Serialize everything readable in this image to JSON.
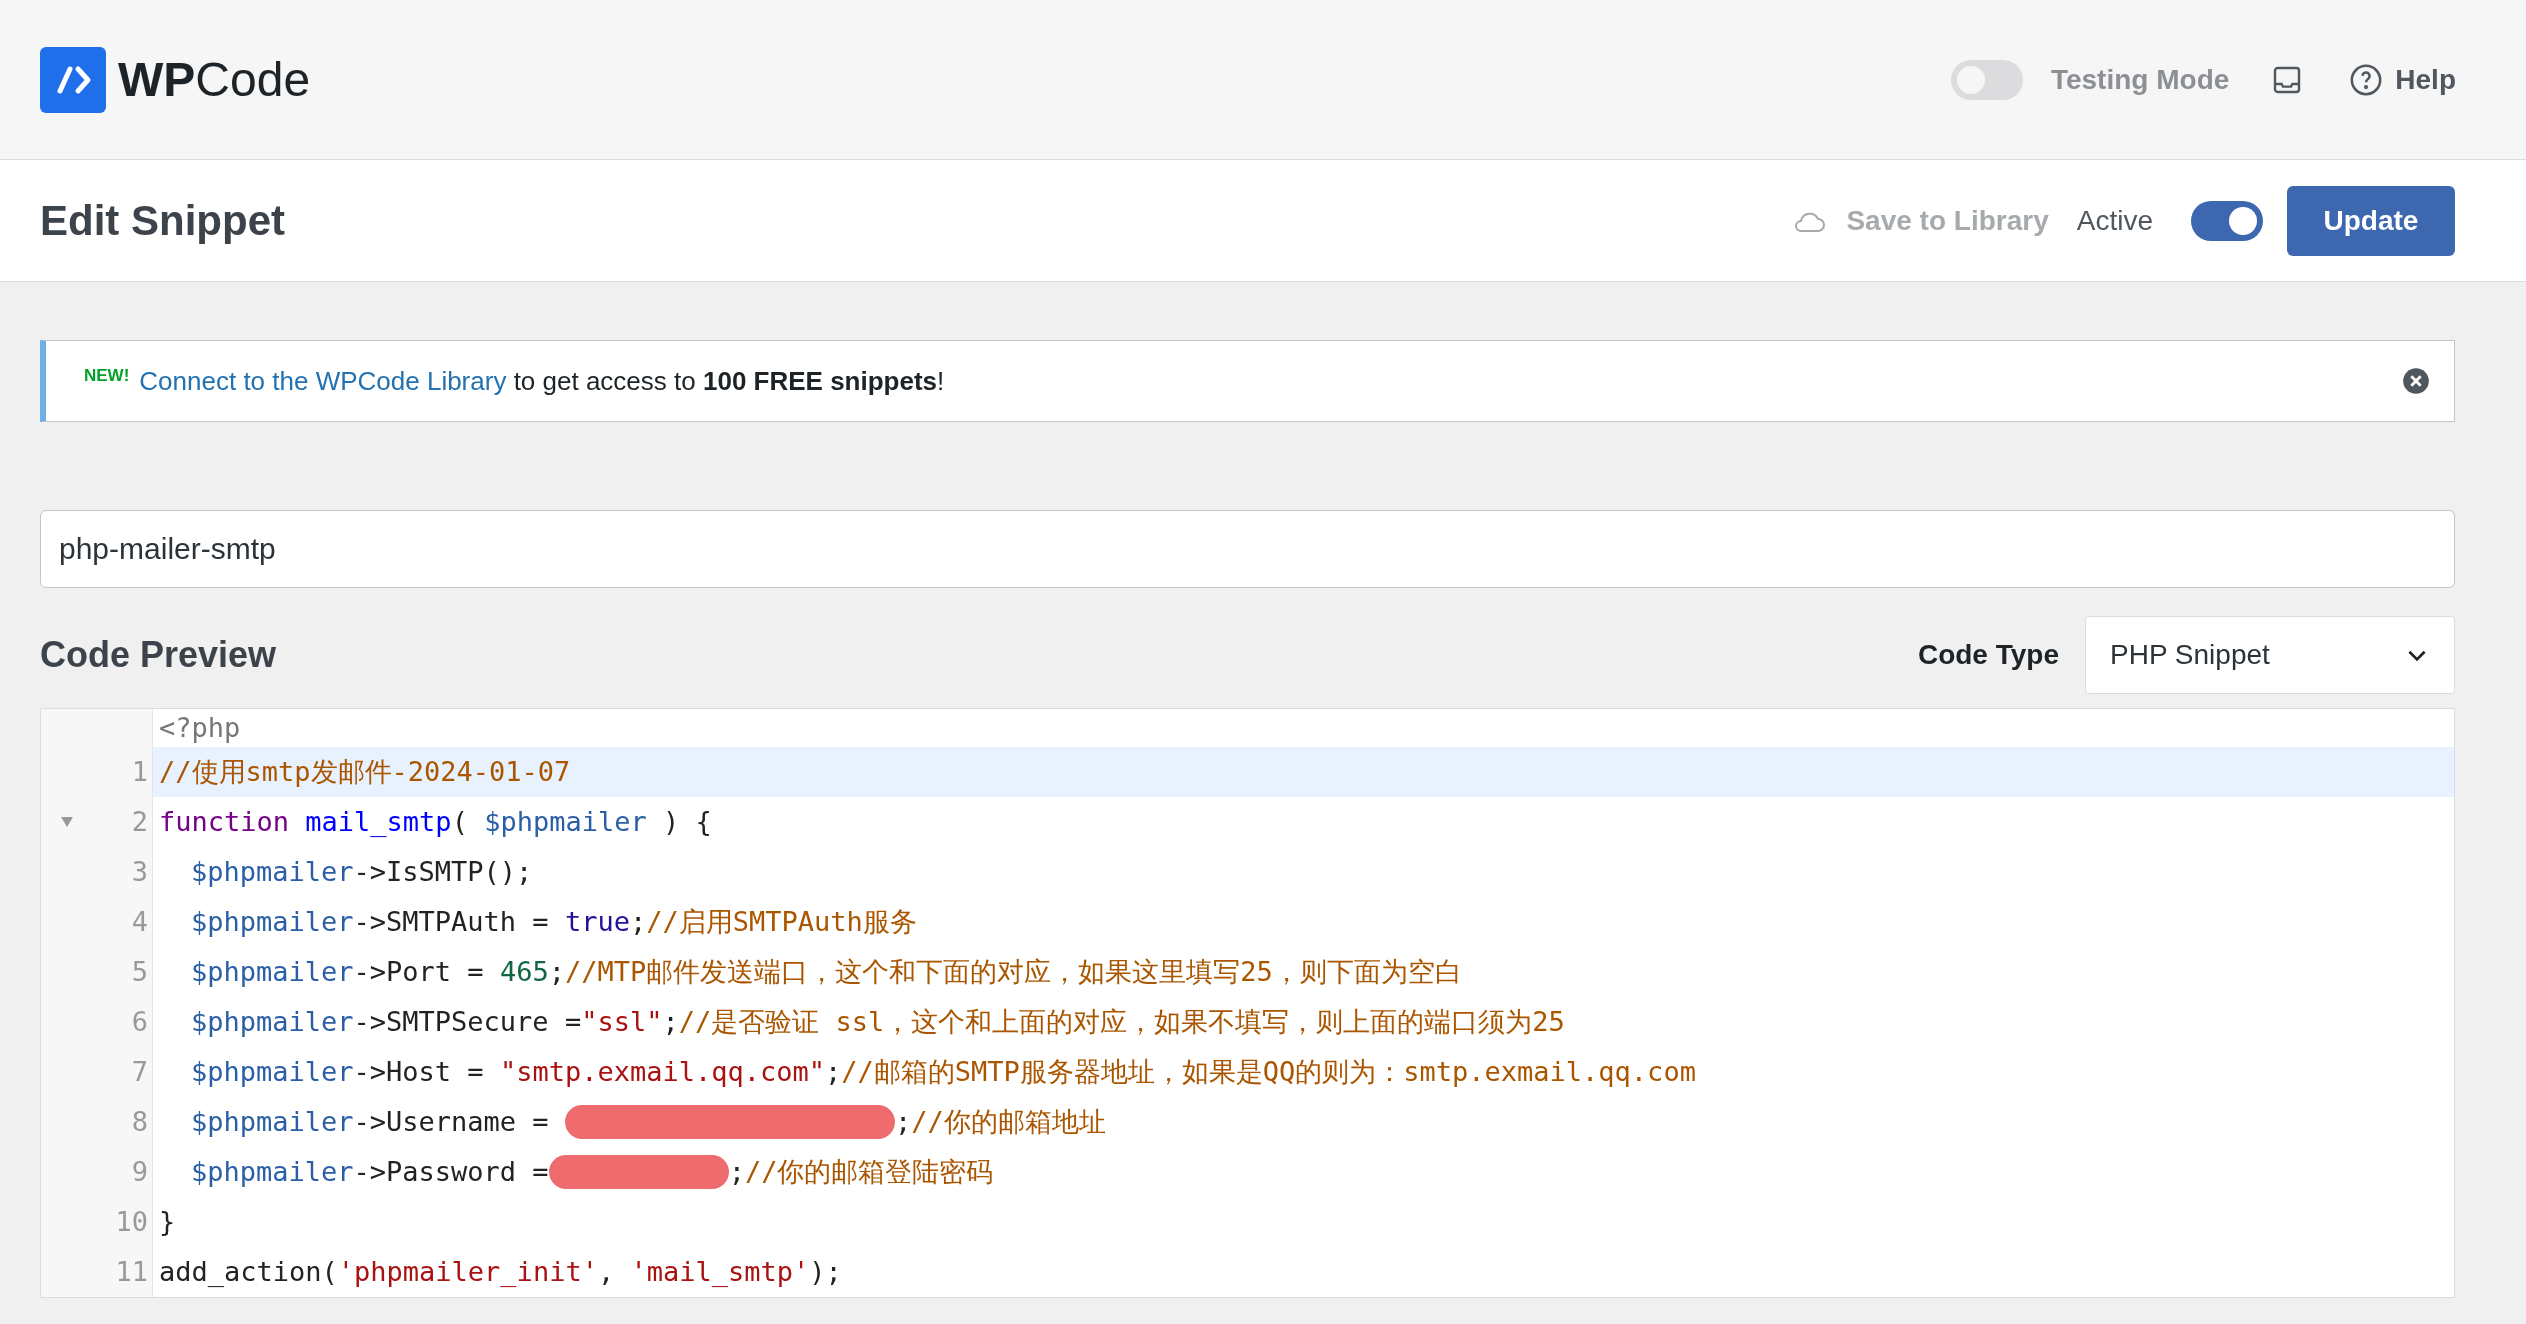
{
  "header": {
    "brand": "**WP**Code",
    "testing_mode": {
      "label": "Testing Mode",
      "on": false
    },
    "help": "Help"
  },
  "toolbar": {
    "title": "Edit Snippet",
    "save_to_library": "Save to Library",
    "active": {
      "label": "Active",
      "on": true
    },
    "update": "Update"
  },
  "notice": {
    "badge": "NEW!",
    "link": "Connect to the WPCode Library",
    "text": " to get access to **100 FREE snippets**!"
  },
  "snippet_title": {
    "value": "php-mailer-smtp"
  },
  "code_preview": {
    "title": "Code Preview",
    "code_type_label": "Code Type",
    "code_type": "PHP Snippet"
  },
  "editor": {
    "lines": [
      {
        "selected": false,
        "foldable": false,
        "indented": false,
        "tokens": [
          {
            "kind": "meta",
            "text": "<?php"
          }
        ]
      },
      {
        "number": "1",
        "selected": true,
        "foldable": false,
        "indented": false,
        "tokens": [
          {
            "kind": "comment",
            "text": "//使用smtp发邮件-2024-01-07"
          }
        ]
      },
      {
        "number": "2",
        "selected": false,
        "foldable": true,
        "indented": false,
        "tokens": [
          {
            "kind": "keyword",
            "text": "function"
          },
          {
            "kind": "space"
          },
          {
            "kind": "def",
            "text": "mail_smtp"
          },
          {
            "kind": "plain",
            "text": "( "
          },
          {
            "kind": "variable",
            "text": "$phpmailer"
          },
          {
            "kind": "plain",
            "text": " ) {"
          }
        ]
      },
      {
        "number": "3",
        "selected": false,
        "foldable": false,
        "indented": true,
        "tokens": [
          {
            "kind": "variable",
            "text": "$phpmailer"
          },
          {
            "kind": "plain",
            "text": "->IsSMTP();"
          }
        ]
      },
      {
        "number": "4",
        "selected": false,
        "foldable": false,
        "indented": true,
        "tokens": [
          {
            "kind": "variable",
            "text": "$phpmailer"
          },
          {
            "kind": "plain",
            "text": "->SMTPAuth = "
          },
          {
            "kind": "atom",
            "text": "true"
          },
          {
            "kind": "plain",
            "text": ";"
          },
          {
            "kind": "comment",
            "text": "//启用SMTPAuth服务"
          }
        ]
      },
      {
        "number": "5",
        "selected": false,
        "foldable": false,
        "indented": true,
        "tokens": [
          {
            "kind": "variable",
            "text": "$phpmailer"
          },
          {
            "kind": "plain",
            "text": "->Port = "
          },
          {
            "kind": "number",
            "text": "465"
          },
          {
            "kind": "plain",
            "text": ";"
          },
          {
            "kind": "comment",
            "text": "//MTP邮件发送端口，这个和下面的对应，如果这里填写25，则下面为空白"
          }
        ]
      },
      {
        "number": "6",
        "selected": false,
        "foldable": false,
        "indented": true,
        "tokens": [
          {
            "kind": "variable",
            "text": "$phpmailer"
          },
          {
            "kind": "plain",
            "text": "->SMTPSecure ="
          },
          {
            "kind": "string",
            "text": "\"ssl\""
          },
          {
            "kind": "plain",
            "text": ";"
          },
          {
            "kind": "comment",
            "text": "//是否验证 ssl，这个和上面的对应，如果不填写，则上面的端口须为25"
          }
        ]
      },
      {
        "number": "7",
        "selected": false,
        "foldable": false,
        "indented": true,
        "tokens": [
          {
            "kind": "variable",
            "text": "$phpmailer"
          },
          {
            "kind": "plain",
            "text": "->Host = "
          },
          {
            "kind": "string",
            "text": "\"smtp.exmail.qq.com\""
          },
          {
            "kind": "plain",
            "text": ";"
          },
          {
            "kind": "comment",
            "text": "//邮箱的SMTP服务器地址，如果是QQ的则为：smtp.exmail.qq.com"
          }
        ]
      },
      {
        "number": "8",
        "selected": false,
        "foldable": false,
        "indented": true,
        "tokens": [
          {
            "kind": "variable",
            "text": "$phpmailer"
          },
          {
            "kind": "plain",
            "text": "->Username = "
          },
          {
            "kind": "redacted"
          },
          {
            "kind": "plain",
            "text": ";"
          },
          {
            "kind": "comment",
            "text": "//你的邮箱地址"
          }
        ]
      },
      {
        "number": "9",
        "selected": false,
        "foldable": false,
        "indented": true,
        "tokens": [
          {
            "kind": "variable",
            "text": "$phpmailer"
          },
          {
            "kind": "plain",
            "text": "->Password ="
          },
          {
            "kind": "redacted"
          },
          {
            "kind": "plain",
            "text": ";"
          },
          {
            "kind": "comment",
            "text": "//你的邮箱登陆密码"
          }
        ]
      },
      {
        "number": "10",
        "selected": false,
        "foldable": false,
        "indented": false,
        "tokens": [
          {
            "kind": "plain",
            "text": "}"
          }
        ]
      },
      {
        "number": "11",
        "selected": false,
        "foldable": false,
        "indented": false,
        "tokens": [
          {
            "kind": "plain",
            "text": "add_action("
          },
          {
            "kind": "string",
            "text": "'phpmailer_init'"
          },
          {
            "kind": "plain",
            "text": ", "
          },
          {
            "kind": "string",
            "text": "'mail_smtp'"
          },
          {
            "kind": "plain",
            "text": ");"
          }
        ]
      }
    ]
  }
}
